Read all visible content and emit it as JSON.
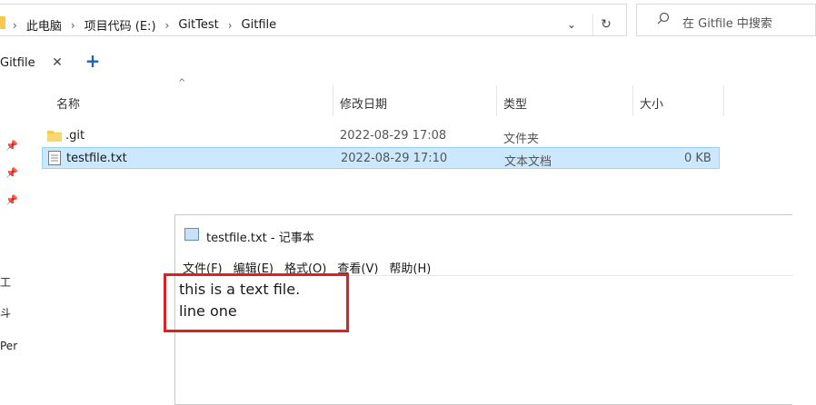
{
  "address_bar": {
    "breadcrumbs": [
      "此电脑",
      "项目代码 (E:)",
      "GitTest",
      "Gitfile"
    ],
    "search_placeholder": "在 Gitfile 中搜索"
  },
  "tabs": [
    {
      "label": "Gitfile"
    }
  ],
  "columns": {
    "name": "名称",
    "modified": "修改日期",
    "type": "类型",
    "size": "大小"
  },
  "files": [
    {
      "name": ".git",
      "modified": "2022-08-29 17:08",
      "type": "文件夹",
      "size": "",
      "icon": "folder-icon",
      "selected": false
    },
    {
      "name": "testfile.txt",
      "modified": "2022-08-29 17:10",
      "type": "文本文档",
      "size": "0 KB",
      "icon": "text-file-icon",
      "selected": true
    }
  ],
  "sidebar_fragments": [
    "工",
    "斗",
    "Per"
  ],
  "notepad": {
    "title": "testfile.txt - 记事本",
    "menu": [
      "文件(F)",
      "编辑(E)",
      "格式(O)",
      "查看(V)",
      "帮助(H)"
    ],
    "content_lines": [
      "this is a text file.",
      "line one"
    ]
  },
  "colors": {
    "selection_bg": "#cce8ff",
    "highlight_border": "#e02020",
    "add_tab_blue": "#1f5fbf"
  }
}
